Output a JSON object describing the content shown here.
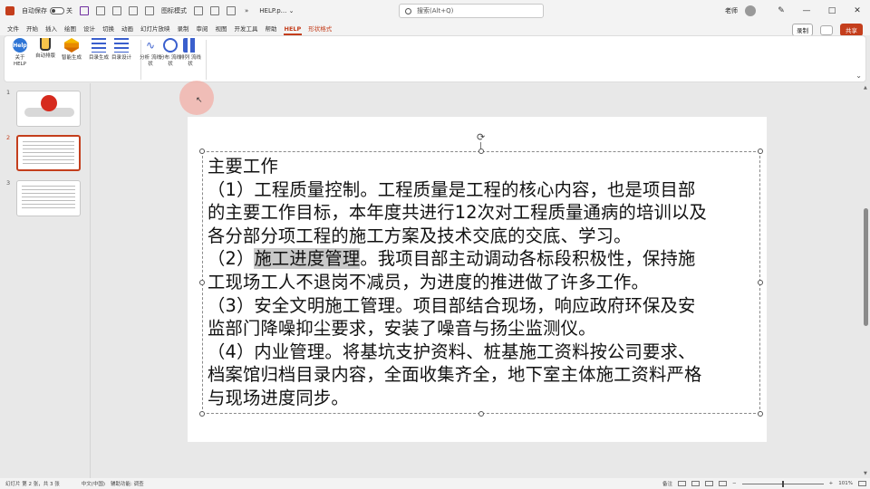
{
  "titlebar": {
    "autosave_label": "自动保存",
    "autosave_state": "关",
    "more_label": "»",
    "quick_label": "图标模式",
    "doc_title": "HELP.p... ⌄",
    "search_placeholder": "搜索(Alt+Q)",
    "user_name": "老师",
    "min": "—",
    "max": "□",
    "close": "✕"
  },
  "tabs": {
    "items": [
      "文件",
      "开始",
      "插入",
      "绘图",
      "设计",
      "切换",
      "动画",
      "幻灯片放映",
      "录制",
      "审阅",
      "视图",
      "开发工具",
      "帮助",
      "HELP",
      "形状格式"
    ],
    "active_index": 13,
    "accent_index": 14,
    "record_label": "录制",
    "share_label": "共享"
  },
  "ribbon": {
    "buttons": [
      {
        "icon": "help-icon",
        "label": "关于 HELP"
      },
      {
        "icon": "cup-icon",
        "label": "自动排版"
      },
      {
        "icon": "layers-icon",
        "label": "智能生成"
      },
      {
        "icon": "lines-icon",
        "label": "目录生成"
      },
      {
        "icon": "lines-icon",
        "label": "目录设计"
      },
      {
        "icon": "wave-icon",
        "label": "分析 流线状"
      },
      {
        "icon": "target-icon",
        "label": "分布 流线状"
      },
      {
        "icon": "grid-icon",
        "label": "排列 流线状"
      }
    ]
  },
  "slides": [
    {
      "number": "1"
    },
    {
      "number": "2"
    },
    {
      "number": "3"
    }
  ],
  "slide_content": {
    "line1": "主要工作",
    "line2": "（1）工程质量控制。工程质量是工程的核心内容，也是项目部",
    "line3": "的主要工作目标，本年度共进行12次对工程质量通病的培训以及",
    "line4": "各分部分项工程的施工方案及技术交底的交底、学习。",
    "line5_prefix": "（2）",
    "line5_highlight": "施工进度管理",
    "line5_suffix": "。我项目部主动调动各标段积极性，保持施",
    "line6": "工现场工人不退岗不减员，为进度的推进做了许多工作。",
    "line7": "（3）安全文明施工管理。项目部结合现场，响应政府环保及安",
    "line8": "监部门降噪抑尘要求，安装了噪音与扬尘监测仪。",
    "line9": "（4）内业管理。将基坑支护资料、桩基施工资料按公司要求、",
    "line10": "档案馆归档目录内容，全面收集齐全，地下室主体施工资料严格",
    "line11": "与现场进度同步。"
  },
  "statusbar": {
    "slide_info": "幻灯片 第 2 张，共 3 张",
    "language": "中文(中国)",
    "accessibility": "辅助功能: 调查",
    "notes_label": "备注",
    "zoom": "101%"
  },
  "colors": {
    "accent": "#c43e1c",
    "highlight": "#c9c9c9"
  }
}
